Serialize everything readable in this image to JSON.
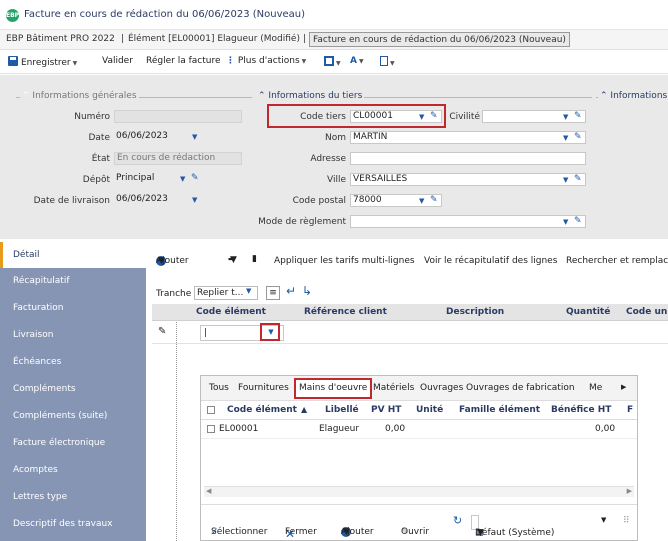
{
  "window": {
    "logo_text": "EBP",
    "title": "Facture en cours de rédaction du 06/06/2023 (Nouveau)"
  },
  "breadcrumb": {
    "items": [
      "EBP Bâtiment PRO 2022",
      "Élément [EL00001] Elagueur (Modifié)",
      "Facture en cours de rédaction du 06/06/2023 (Nouveau)"
    ]
  },
  "toolbar": {
    "save": "Enregistrer",
    "validate": "Valider",
    "settle": "Régler la facture",
    "more": "Plus d'actions"
  },
  "general": {
    "section_title": "Informations générales",
    "numero_label": "Numéro",
    "numero_value": "",
    "date_label": "Date",
    "date_value": "06/06/2023",
    "etat_label": "État",
    "etat_value": "En cours de rédaction",
    "depot_label": "Dépôt",
    "depot_value": "Principal",
    "livraison_label": "Date de livraison",
    "livraison_value": "06/06/2023"
  },
  "tiers": {
    "section_title": "Informations du tiers",
    "code_label": "Code tiers",
    "code_value": "CL00001",
    "civilite_label": "Civilité",
    "civilite_value": "",
    "nom_label": "Nom",
    "nom_value": "MARTIN",
    "adresse_label": "Adresse",
    "adresse_value": "",
    "ville_label": "Ville",
    "ville_value": "VERSAILLES",
    "cp_label": "Code postal",
    "cp_value": "78000",
    "reglement_label": "Mode de règlement",
    "reglement_value": ""
  },
  "other_section_title": "Informations",
  "sidebar": {
    "items": [
      "Détail",
      "Récapitulatif",
      "Facturation",
      "Livraison",
      "Échéances",
      "Compléments",
      "Compléments (suite)",
      "Facture électronique",
      "Acomptes",
      "Lettres type",
      "Descriptif des travaux"
    ]
  },
  "detail_toolbar": {
    "add": "Ajouter",
    "apply_rates": "Appliquer les tarifs multi-lignes",
    "see_recap": "Voir le récapitulatif des lignes",
    "search_replace": "Rechercher et remplac",
    "tranche_label": "Tranche",
    "tranche_value": "Replier t..."
  },
  "grid": {
    "columns": [
      "Code élément",
      "Référence client",
      "Description",
      "Quantité",
      "Code uni"
    ],
    "edit_value": "|"
  },
  "popup": {
    "tabs": [
      "Tous",
      "Fournitures",
      "Mains d'oeuvre",
      "Matériels",
      "Ouvrages",
      "Ouvrages de fabrication",
      "Me"
    ],
    "active_tab": "Mains d'oeuvre",
    "columns": [
      "Code élément",
      "Libellé",
      "PV HT",
      "Unité",
      "Famille élément",
      "Bénéfice HT",
      "F"
    ],
    "rows": [
      {
        "code": "EL00001",
        "libelle": "Elagueur",
        "pv_ht": "0,00",
        "unite": "",
        "famille": "",
        "benefice": "0,00"
      }
    ],
    "footer": {
      "select": "Sélectionner",
      "close": "Fermer",
      "add": "Ajouter",
      "open": "Ouvrir",
      "view": "Défaut (Système)"
    }
  },
  "colors": {
    "accent_blue": "#1f5aa8",
    "sidebar_bg": "#8795b5",
    "highlight_red": "#c0282d",
    "active_marker": "#e89a1a",
    "logo_green": "#27a36a"
  }
}
